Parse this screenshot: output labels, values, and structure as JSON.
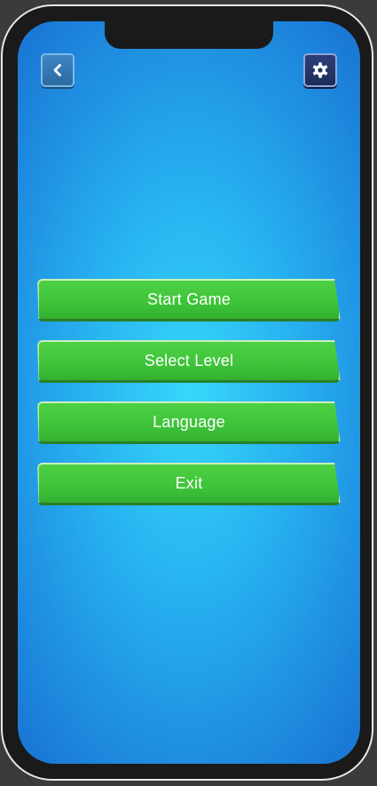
{
  "top_bar": {
    "back_icon": "chevron-left-icon",
    "settings_icon": "gear-icon"
  },
  "menu": {
    "items": [
      {
        "label": "Start Game"
      },
      {
        "label": "Select Level"
      },
      {
        "label": "Language"
      },
      {
        "label": "Exit"
      }
    ]
  },
  "colors": {
    "background_center": "#37d7fa",
    "background_edge": "#1a79d6",
    "button_green": "#3ec33a",
    "back_button": "#2f74b1",
    "settings_button": "#25336a",
    "device_frame": "#1a1a1a"
  }
}
